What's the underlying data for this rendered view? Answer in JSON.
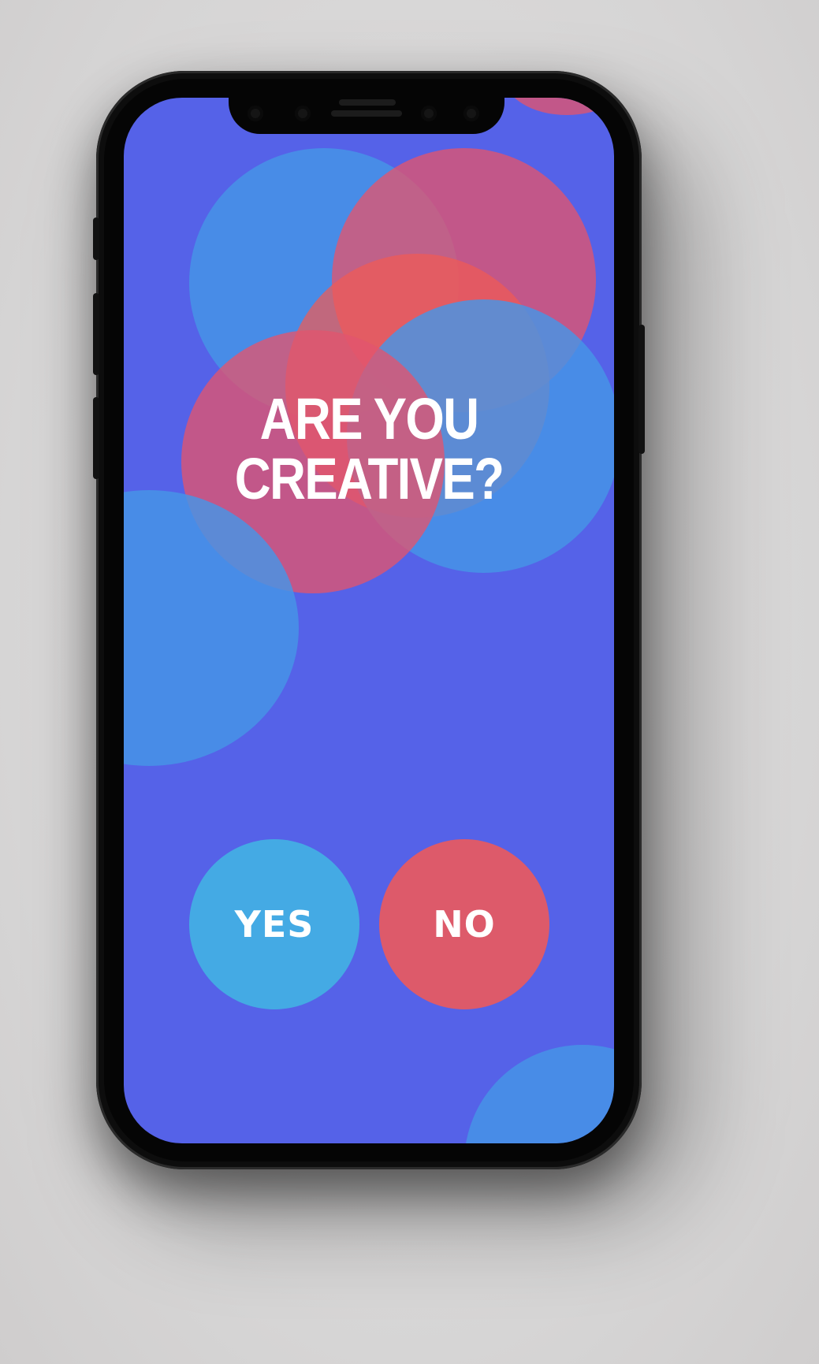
{
  "screen": {
    "headline_line1": "ARE YOU",
    "headline_line2": "CREATIVE?"
  },
  "buttons": {
    "yes_label": "YES",
    "no_label": "NO"
  },
  "colors": {
    "background": "#5562e8",
    "yes": "#44aae4",
    "no": "#dd5a6a",
    "bubble_blue": "#4696e6",
    "bubble_red": "#e1556e"
  }
}
